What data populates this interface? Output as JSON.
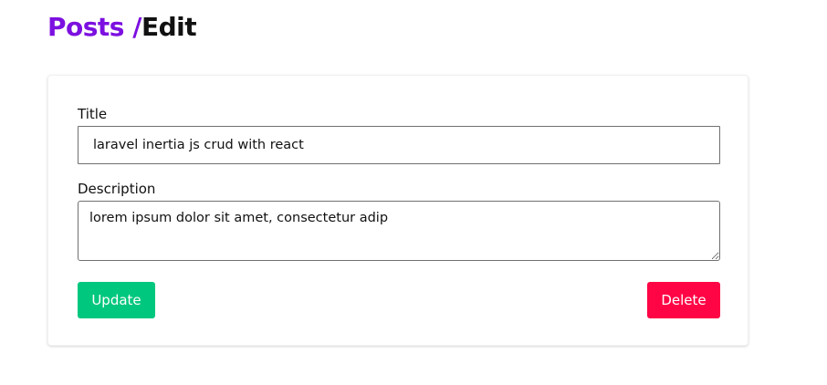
{
  "breadcrumb": {
    "parent": "Posts",
    "separator": " /",
    "current": "Edit"
  },
  "form": {
    "title_label": "Title",
    "title_value": "laravel inertia js crud with react",
    "description_label": "Description",
    "description_value": "lorem ipsum dolor sit amet, consectetur adip"
  },
  "actions": {
    "update_label": "Update",
    "delete_label": "Delete"
  },
  "colors": {
    "breadcrumb_link": "#7c10e0",
    "update_button": "#00c77e",
    "delete_button": "#ff0546"
  }
}
